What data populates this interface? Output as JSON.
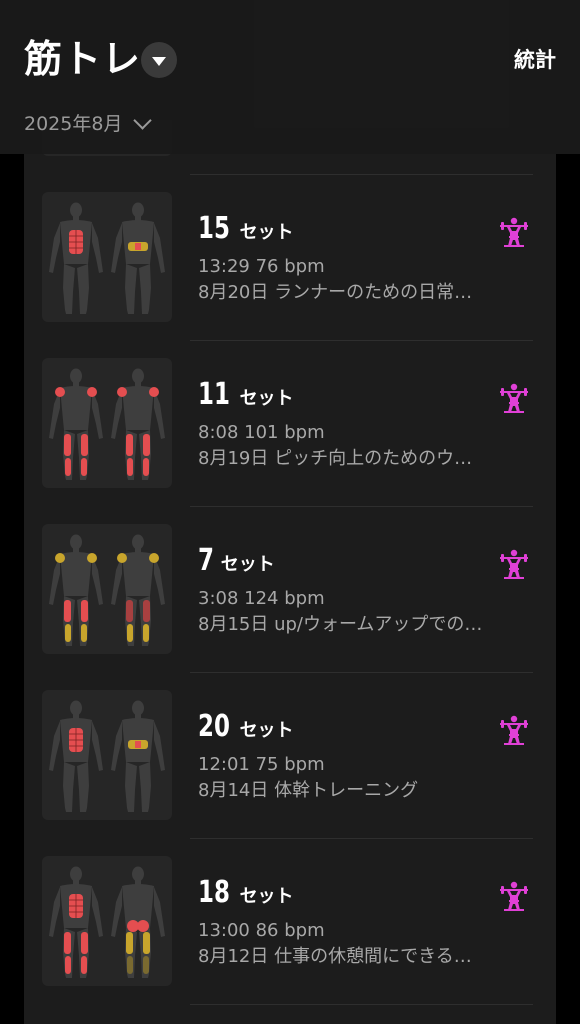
{
  "header": {
    "title": "筋トレ",
    "stats_label": "統計",
    "month_label": "2025年8月"
  },
  "colors": {
    "accent": "#e040d6",
    "muscle_red": "#e44e50",
    "muscle_yellow": "#c8a52c",
    "body": "#3e3e3e"
  },
  "workouts": [
    {
      "sets": "15",
      "unit": "セット",
      "meta": "13:29 76 bpm",
      "desc": "8月20日 ランナーのための日常…",
      "icon": "weightlifting-icon"
    },
    {
      "sets": "11",
      "unit": "セット",
      "meta": "8:08 101 bpm",
      "desc": "8月19日 ピッチ向上のためのウ…",
      "icon": "weightlifting-icon"
    },
    {
      "sets": "7",
      "unit": "セット",
      "meta": "3:08 124 bpm",
      "desc": "8月15日 up/ウォームアップでの…",
      "icon": "weightlifting-icon"
    },
    {
      "sets": "20",
      "unit": "セット",
      "meta": "12:01 75 bpm",
      "desc": "8月14日 体幹トレーニング",
      "icon": "weightlifting-icon"
    },
    {
      "sets": "18",
      "unit": "セット",
      "meta": "13:00 86 bpm",
      "desc": "8月12日 仕事の休憩間にできる…",
      "icon": "weightlifting-icon"
    }
  ]
}
